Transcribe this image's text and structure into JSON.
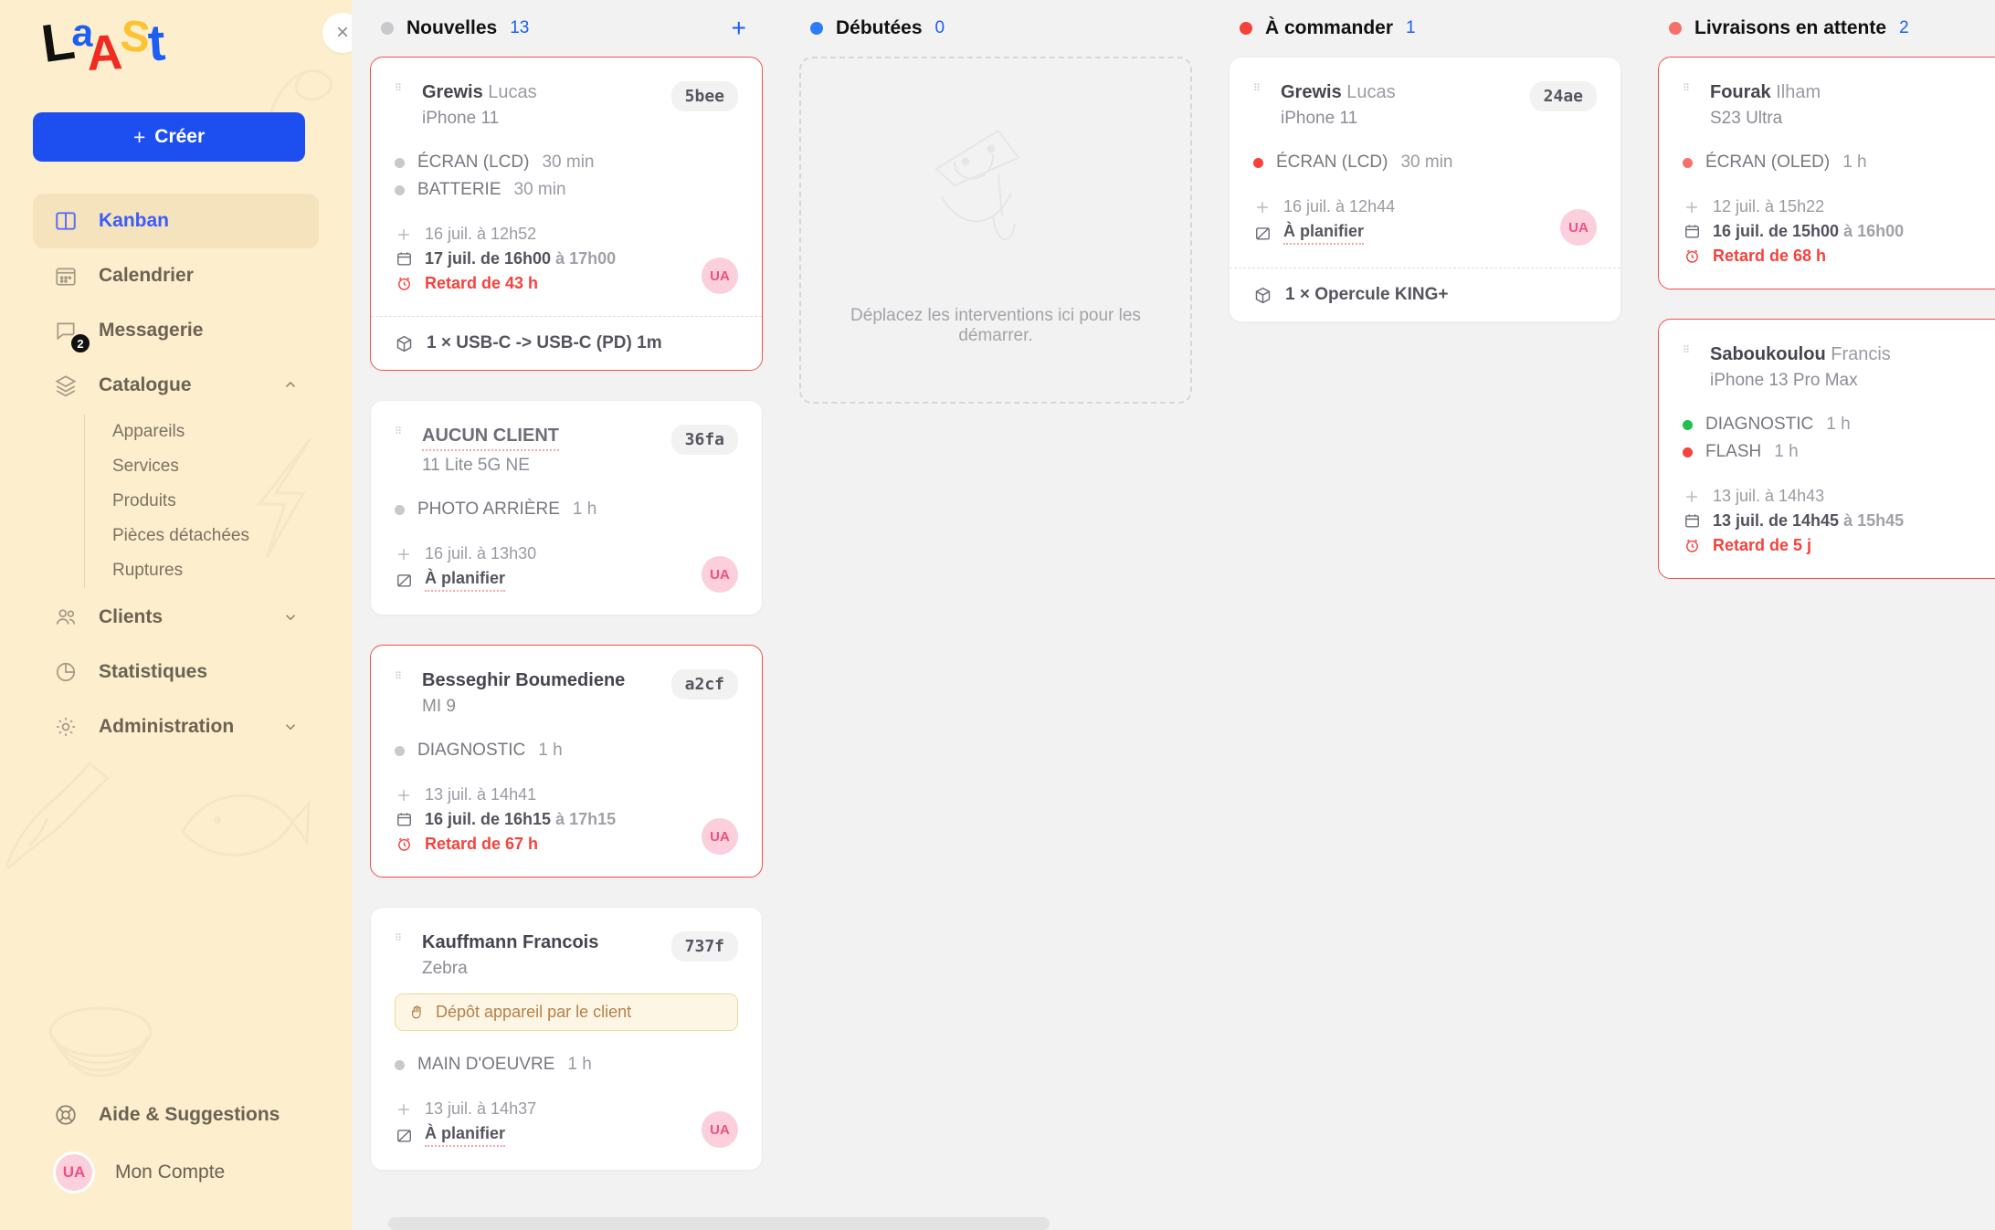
{
  "sidebar": {
    "logo": {
      "parts": [
        "L",
        "a",
        "A",
        "S",
        "t"
      ]
    },
    "create_label": "Créer",
    "items": [
      {
        "label": "Kanban",
        "icon": "kanban-icon",
        "active": true
      },
      {
        "label": "Calendrier",
        "icon": "calendar-icon"
      },
      {
        "label": "Messagerie",
        "icon": "message-icon",
        "badge": "2"
      },
      {
        "label": "Catalogue",
        "icon": "layers-icon",
        "chevron": "up"
      }
    ],
    "catalogue_children": [
      "Appareils",
      "Services",
      "Produits",
      "Pièces détachées",
      "Ruptures"
    ],
    "items_after": [
      {
        "label": "Clients",
        "icon": "users-icon",
        "chevron": "down"
      },
      {
        "label": "Statistiques",
        "icon": "pie-chart-icon"
      },
      {
        "label": "Administration",
        "icon": "gear-icon",
        "chevron": "down"
      }
    ],
    "help_label": "Aide & Suggestions",
    "account_label": "Mon Compte",
    "account_initials": "UA"
  },
  "close_button": "×",
  "columns": [
    {
      "title": "Nouvelles",
      "count": "13",
      "dot_color": "#c9c9cd",
      "has_add": true,
      "add_label": "+",
      "cards": [
        {
          "ref": "5bee",
          "client": "Grewis Lucas",
          "client_bold": "Grewis",
          "client_light": "Lucas",
          "device": "iPhone 11",
          "late": true,
          "services": [
            {
              "name": "ÉCRAN (LCD)",
              "duration": "30 min",
              "color": "#c9c9cd"
            },
            {
              "name": "BATTERIE",
              "duration": "30 min",
              "color": "#c9c9cd"
            }
          ],
          "created": "16 juil. à 12h52",
          "scheduled": "17 juil. de 16h00 à 17h00",
          "scheduled_from": "17 juil. de 16h00",
          "scheduled_to": "à 17h00",
          "delay": "Retard de 43 h",
          "assignee": "UA",
          "part": "1 × USB-C -> USB-C (PD) 1m"
        },
        {
          "ref": "36fa",
          "client": "AUCUN CLIENT",
          "no_client": true,
          "device": "11 Lite 5G NE",
          "late": false,
          "services": [
            {
              "name": "PHOTO ARRIÈRE",
              "duration": "1 h",
              "color": "#c9c9cd"
            }
          ],
          "created": "16 juil. à 13h30",
          "plan_label": "À planifier",
          "assignee": "UA"
        },
        {
          "ref": "a2cf",
          "client": "Besseghir Boumediene",
          "client_bold": "Besseghir Boumediene",
          "client_light": "",
          "device": "MI 9",
          "late": true,
          "services": [
            {
              "name": "DIAGNOSTIC",
              "duration": "1 h",
              "color": "#c9c9cd"
            }
          ],
          "created": "13 juil. à 14h41",
          "scheduled_from": "16 juil. de 16h15",
          "scheduled_to": "à 17h15",
          "delay": "Retard de 67 h",
          "assignee": "UA"
        },
        {
          "ref": "737f",
          "client": "Kauffmann Francois",
          "client_bold": "Kauffmann Francois",
          "client_light": "",
          "device": "Zebra",
          "late": false,
          "alert": "Dépôt appareil par le client",
          "services": [
            {
              "name": "MAIN D'OEUVRE",
              "duration": "1 h",
              "color": "#c9c9cd"
            }
          ],
          "created": "13 juil. à 14h37",
          "plan_label": "À planifier",
          "assignee": "UA"
        }
      ]
    },
    {
      "title": "Débutées",
      "count": "0",
      "dot_color": "#2f7df6",
      "has_add": false,
      "empty_text": "Déplacez les interventions ici pour les démarrer.",
      "cards": []
    },
    {
      "title": "À commander",
      "count": "1",
      "dot_color": "#f5423c",
      "has_add": false,
      "cards": [
        {
          "ref": "24ae",
          "client": "Grewis Lucas",
          "client_bold": "Grewis",
          "client_light": "Lucas",
          "device": "iPhone 11",
          "late": false,
          "services": [
            {
              "name": "ÉCRAN (LCD)",
              "duration": "30 min",
              "color": "#f5423c"
            }
          ],
          "created": "16 juil. à 12h44",
          "plan_label": "À planifier",
          "assignee": "UA",
          "part": "1 × Opercule KING+"
        }
      ]
    },
    {
      "title": "Livraisons en attente",
      "count": "2",
      "dot_color": "#f5706a",
      "has_add": false,
      "cards": [
        {
          "ref": "",
          "client": "Fourak Ilham",
          "client_bold": "Fourak",
          "client_light": "Ilham",
          "device": "S23 Ultra",
          "late": true,
          "services": [
            {
              "name": "ÉCRAN (OLED)",
              "duration": "1 h",
              "color": "#f5706a"
            }
          ],
          "created": "12 juil. à 15h22",
          "scheduled_from": "16 juil. de 15h00",
          "scheduled_to": "à 16h00",
          "delay": "Retard de 68 h",
          "assignee": ""
        },
        {
          "ref": "",
          "client": "Saboukoulou Francis",
          "client_bold": "Saboukoulou",
          "client_light": "Francis",
          "device": "iPhone 13 Pro Max",
          "late": true,
          "services": [
            {
              "name": "DIAGNOSTIC",
              "duration": "1 h",
              "color": "#1fbf4a"
            },
            {
              "name": "FLASH",
              "duration": "1 h",
              "color": "#f5423c"
            }
          ],
          "created": "13 juil. à 14h43",
          "scheduled_from": "13 juil. de 14h45",
          "scheduled_to": "à 15h45",
          "delay": "Retard de 5 j",
          "assignee": ""
        }
      ]
    }
  ],
  "colors": {
    "sidebar_bg": "#fdeecd",
    "board_bg": "#f2f2f2",
    "accent_blue": "#1d4ff0",
    "late_red": "#f0514d",
    "avatar_pink": "#fbd0dc"
  }
}
